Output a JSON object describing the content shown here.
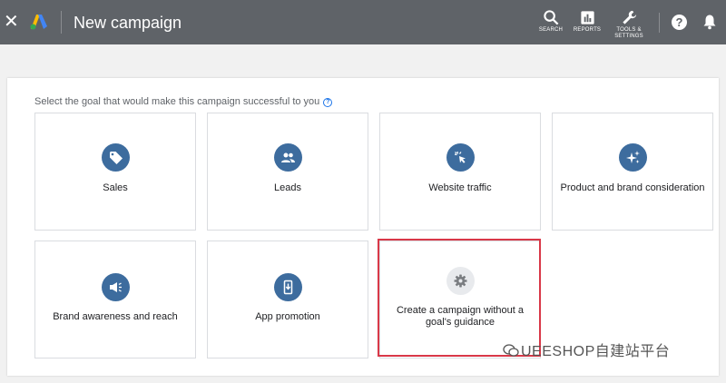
{
  "header": {
    "close_glyph": "✕",
    "title": "New campaign",
    "tools": [
      {
        "label": "SEARCH",
        "icon": "search-icon"
      },
      {
        "label": "REPORTS",
        "icon": "reports-icon"
      },
      {
        "label_line1": "TOOLS &",
        "label_line2": "SETTINGS",
        "icon": "wrench-icon"
      }
    ],
    "help_glyph": "?",
    "background": "#5f6368"
  },
  "main": {
    "prompt": "Select the goal that would make this campaign successful to you",
    "goals": [
      {
        "label": "Sales",
        "icon": "tag-icon"
      },
      {
        "label": "Leads",
        "icon": "people-icon"
      },
      {
        "label": "Website traffic",
        "icon": "cursor-click-icon"
      },
      {
        "label": "Product and brand consideration",
        "icon": "sparkle-icon"
      },
      {
        "label": "Brand awareness and reach",
        "icon": "megaphone-icon"
      },
      {
        "label": "App promotion",
        "icon": "mobile-download-icon"
      },
      {
        "label": "Create a campaign without a goal's guidance",
        "icon": "gear-icon"
      }
    ],
    "accent": "#3d6c9e",
    "highlight_color": "#d93848"
  },
  "watermark": {
    "text": "UEESHOP自建站平台"
  }
}
